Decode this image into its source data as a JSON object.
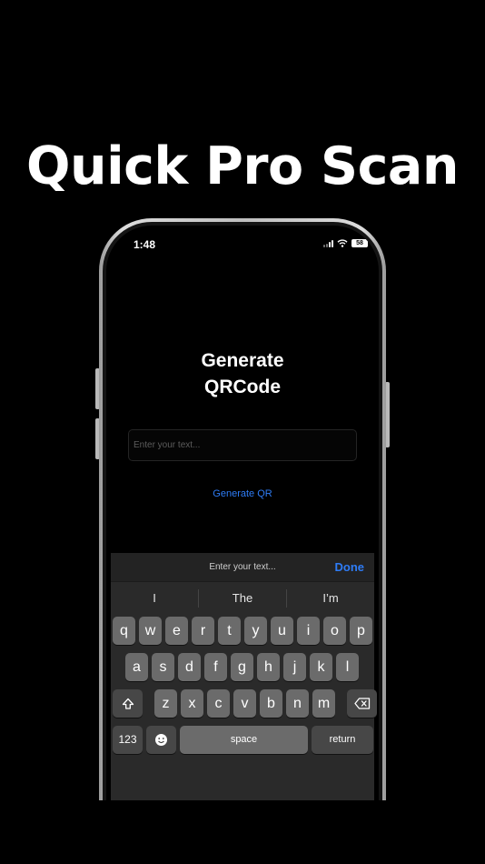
{
  "promo": {
    "headline": "Quick Pro Scan"
  },
  "status_bar": {
    "time": "1:48",
    "battery": "58"
  },
  "app": {
    "title": "Generate\nQRCode",
    "input_placeholder": "Enter your text...",
    "generate_label": "Generate QR"
  },
  "keyboard": {
    "toolbar_prompt": "Enter your text...",
    "done_label": "Done",
    "predictions": [
      "I",
      "The",
      "I’m"
    ],
    "row1": [
      "q",
      "w",
      "e",
      "r",
      "t",
      "y",
      "u",
      "i",
      "o",
      "p"
    ],
    "row2": [
      "a",
      "s",
      "d",
      "f",
      "g",
      "h",
      "j",
      "k",
      "l"
    ],
    "row3": [
      "z",
      "x",
      "c",
      "v",
      "b",
      "n",
      "m"
    ],
    "numbers_label": "123",
    "space_label": "space",
    "return_label": "return"
  },
  "colors": {
    "accent": "#2e7cf6",
    "key": "#6b6b6b",
    "key_dark": "#474747"
  },
  "icons": [
    "wifi-icon",
    "signal-icon",
    "battery-icon",
    "shift-icon",
    "backspace-icon",
    "emoji-icon",
    "globe-icon",
    "dictation-icon"
  ]
}
